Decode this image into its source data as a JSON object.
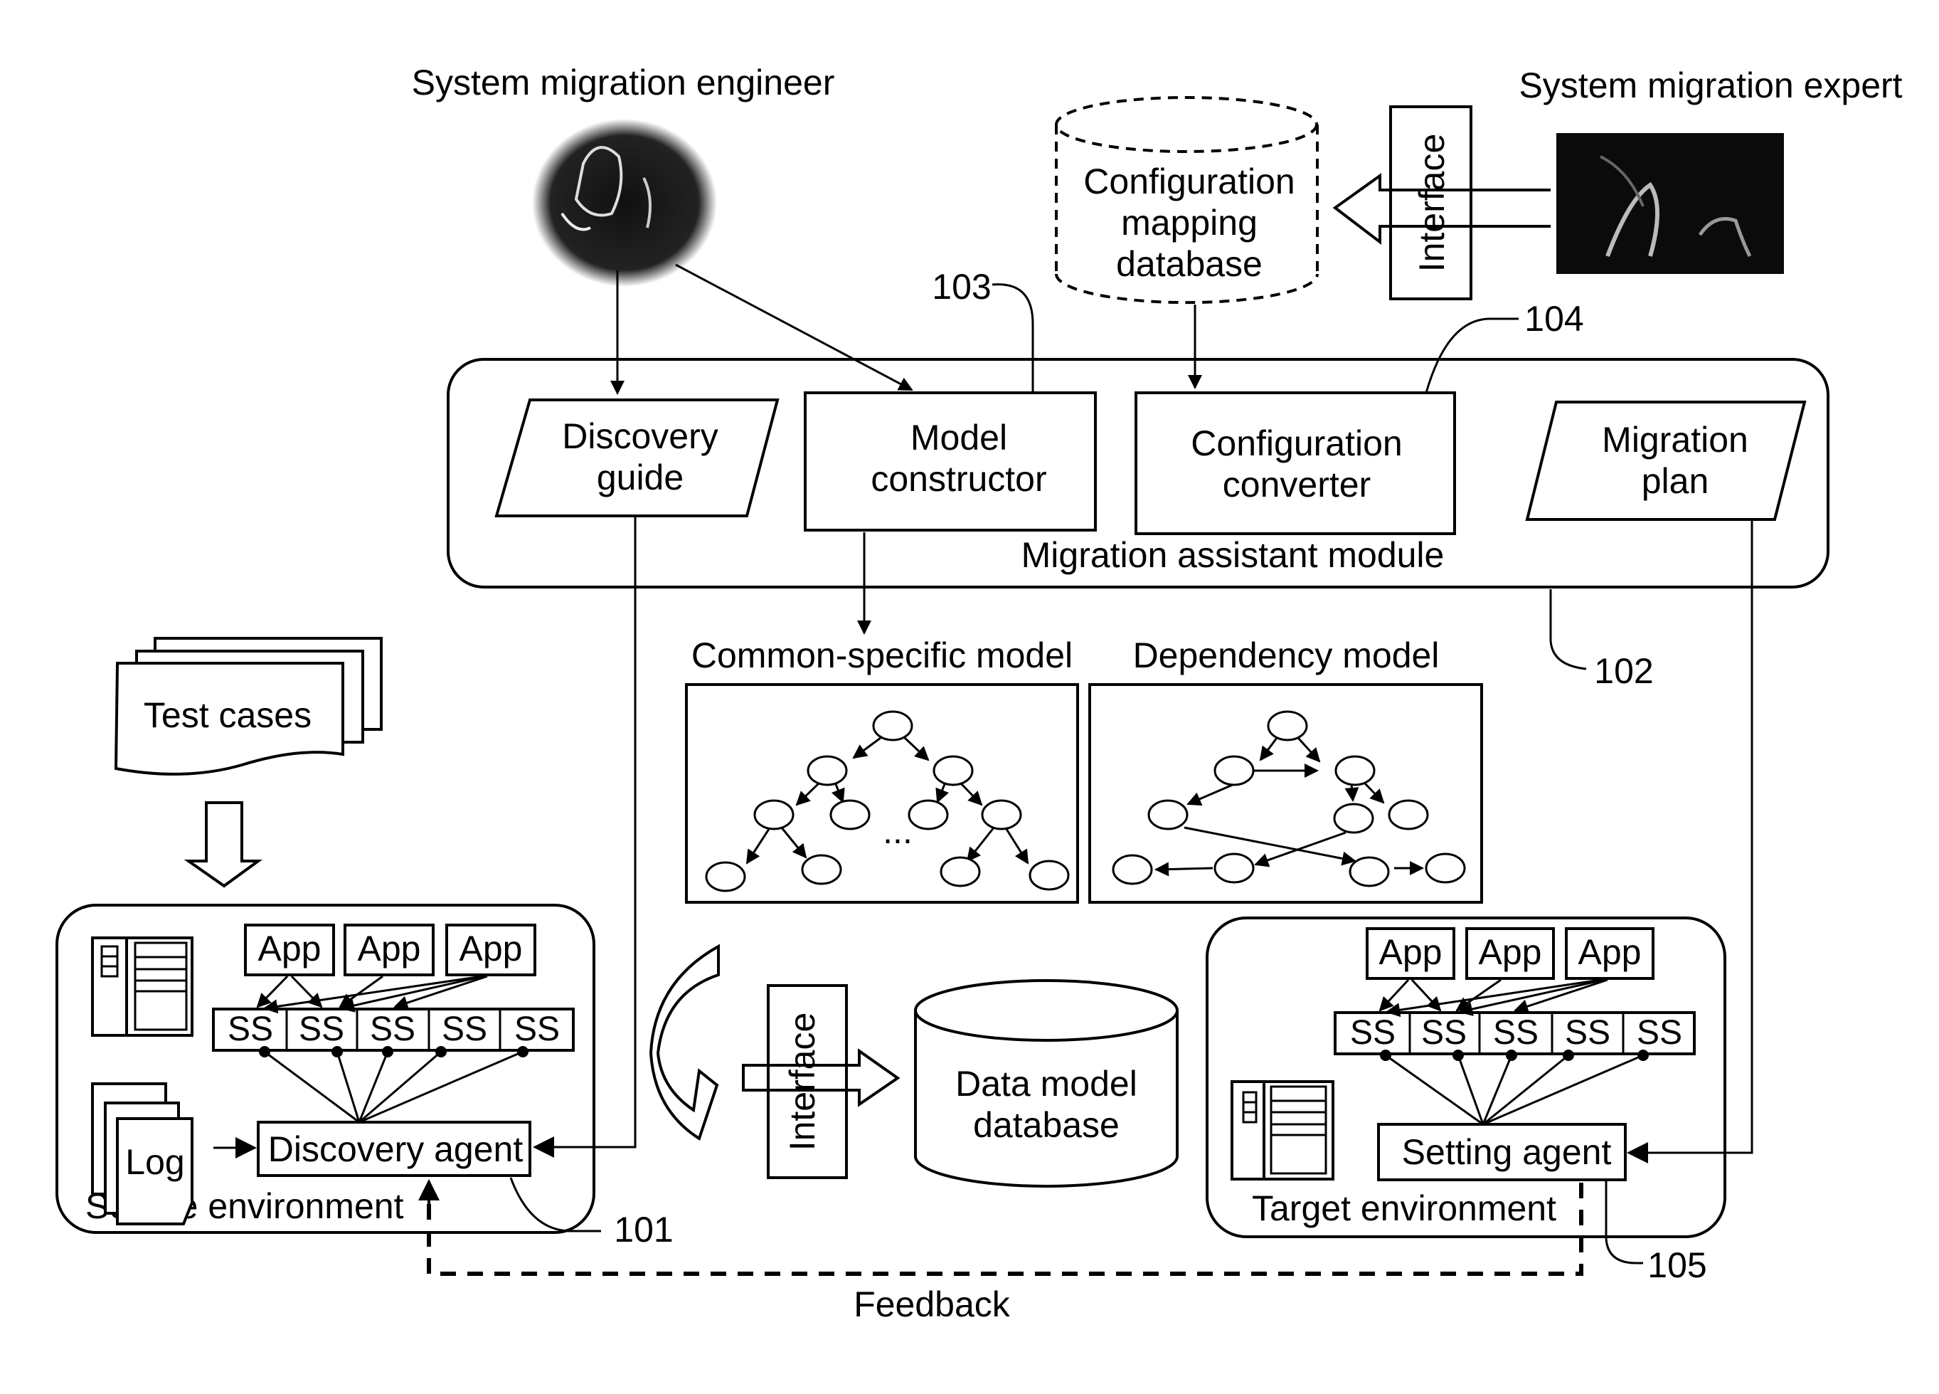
{
  "actors": {
    "engineer_label": "System migration engineer",
    "expert_label": "System migration expert"
  },
  "config_mapping_db": {
    "lines": [
      "Configuration",
      "mapping",
      "database"
    ]
  },
  "interface_top_label": "Interface",
  "migration_assistant_module": {
    "label": "Migration assistant module",
    "ref": "102",
    "discovery_guide": [
      "Discovery",
      "guide"
    ],
    "model_constructor": [
      "Model",
      "constructor"
    ],
    "model_constructor_ref": "103",
    "configuration_converter": [
      "Configuration",
      "converter"
    ],
    "configuration_converter_ref": "104",
    "migration_plan": [
      "Migration",
      "plan"
    ]
  },
  "models": {
    "common_specific_title": "Common-specific model",
    "common_specific_ellipsis": "...",
    "dependency_title": "Dependency model"
  },
  "test_cases_label": "Test cases",
  "source_environment": {
    "label": "Source environment",
    "apps": [
      "App",
      "App",
      "App"
    ],
    "subsystems": [
      "SS",
      "SS",
      "SS",
      "SS",
      "SS"
    ],
    "log_label": "Log",
    "agent_label": "Discovery agent",
    "agent_ref": "101"
  },
  "interface_bottom_label": "Interface",
  "data_model_db": {
    "lines": [
      "Data model",
      "database"
    ]
  },
  "target_environment": {
    "label": "Target environment",
    "apps": [
      "App",
      "App",
      "App"
    ],
    "subsystems": [
      "SS",
      "SS",
      "SS",
      "SS",
      "SS"
    ],
    "agent_label": "Setting agent",
    "agent_ref": "105"
  },
  "feedback_label": "Feedback"
}
